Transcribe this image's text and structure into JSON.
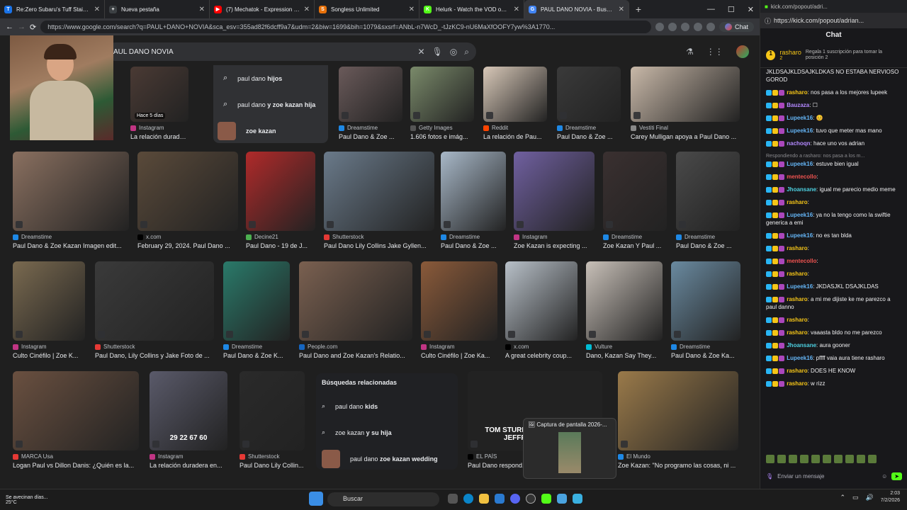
{
  "tabs": [
    {
      "title": "Re:Zero Subaru's Tuff Stairs Edit |",
      "color": "#1a73e8",
      "icon": "T"
    },
    {
      "title": "Nueva pestaña",
      "color": "#3c4043",
      "icon": "+"
    },
    {
      "title": "(7) Mechatok - Expression On You",
      "color": "#ff0000",
      "icon": "▶"
    },
    {
      "title": "Songless Unlimited",
      "color": "#e8710a",
      "icon": "S"
    },
    {
      "title": "Helurk - Watch the VOD on Kick",
      "color": "#53fc18",
      "icon": "K"
    },
    {
      "title": "PAUL DANO NOVIA - Buscar con G",
      "color": "#4285f4",
      "icon": "G"
    }
  ],
  "address": {
    "url": "https://www.google.com/search?q=PAUL+DANO+NOVIA&sca_esv=355ad82f6dcff9a7&udm=2&biw=1699&bih=1079&sxsrf=ANbL-n7WcD_-tJzKC9-nU6MaXfOOFY7yw%3A1770...",
    "chat_label": "Chat"
  },
  "search": {
    "query": "AUL DANO NOVIA"
  },
  "suggestions": [
    {
      "plain": "paul dano ",
      "bold": "hijos"
    },
    {
      "plain": "paul dano ",
      "bold": "y zoe kazan hija"
    },
    {
      "plain": "",
      "bold": "zoe kazan"
    }
  ],
  "row0": [
    {
      "source": "Instagram",
      "caption": "La relación duradera e...",
      "badge": "Hace 5 días",
      "color": "#4a3a34",
      "dot": "#c13584"
    },
    {
      "source": "Dreamstime",
      "caption": "Paul Dano & Zoe ...",
      "color": "#6a5a5a",
      "dot": "#1e88e5"
    },
    {
      "source": "Getty Images",
      "caption": "1.606 fotos e imág...",
      "color": "#7a8a6a",
      "dot": "#555"
    },
    {
      "source": "Reddit",
      "caption": "La relación de Pau...",
      "color": "#d8c8b8",
      "dot": "#ff4500"
    },
    {
      "source": "Dreamstime",
      "caption": "Paul Dano & Zoe ...",
      "color": "#3a3a3a",
      "dot": "#1e88e5"
    },
    {
      "source": "Vestiti Final",
      "caption": "Carey Mulligan apoya a Paul Dano ...",
      "color": "#c8b8a8",
      "dot": "#888"
    }
  ],
  "row1": [
    {
      "source": "Dreamstime",
      "caption": "Paul Dano & Zoe Kazan Imagen edit...",
      "color": "#8a7060",
      "dot": "#1e88e5"
    },
    {
      "source": "x.com",
      "caption": "February 29, 2024. Paul Dano ...",
      "color": "#5a4a3a",
      "dot": "#000"
    },
    {
      "source": "Decine21",
      "caption": "Paul Dano - 19 de J...",
      "color": "#b02a2a",
      "dot": "#4caf50"
    },
    {
      "source": "Shutterstock",
      "caption": "Paul Dano Lily Collins Jake Gyllen...",
      "color": "#6a7a8a",
      "dot": "#e53935"
    },
    {
      "source": "Dreamstime",
      "caption": "Paul Dano & Zoe ...",
      "color": "#a8b8c8",
      "dot": "#1e88e5"
    },
    {
      "source": "Instagram",
      "caption": "Zoe Kazan is expecting ...",
      "color": "#7060a0",
      "dot": "#c13584"
    },
    {
      "source": "Dreamstime",
      "caption": "Zoe Kazan Y Paul ...",
      "color": "#3a3030",
      "dot": "#1e88e5"
    },
    {
      "source": "Dreamstime",
      "caption": "Paul Dano & Zoe ...",
      "color": "#4a4a4a",
      "dot": "#1e88e5"
    }
  ],
  "row2": [
    {
      "source": "Instagram",
      "caption": "Culto Cinéfilo | Zoe K...",
      "color": "#7a6a50",
      "dot": "#c13584"
    },
    {
      "source": "Shutterstock",
      "caption": "Paul Dano, Lily Collins y Jake Foto de ...",
      "color": "#3a3a3a",
      "dot": "#e53935"
    },
    {
      "source": "Dreamstime",
      "caption": "Paul Dano & Zoe K...",
      "color": "#2a7a6a",
      "dot": "#1e88e5"
    },
    {
      "source": "People.com",
      "caption": "Paul Dano and Zoe Kazan's Relatio...",
      "color": "#7a6050",
      "dot": "#1565c0"
    },
    {
      "source": "Instagram",
      "caption": "Culto Cinéfilo | Zoe Ka...",
      "color": "#8a5a3a",
      "dot": "#c13584"
    },
    {
      "source": "x.com",
      "caption": "A great celebrity coup...",
      "color": "#b8c0c8",
      "dot": "#000"
    },
    {
      "source": "Vulture",
      "caption": "Dano, Kazan Say They...",
      "color": "#c8c0b8",
      "dot": "#00bcd4"
    },
    {
      "source": "Dreamstime",
      "caption": "Paul Dano & Zoe Ka...",
      "color": "#6a8aa0",
      "dot": "#1e88e5"
    }
  ],
  "row3": [
    {
      "source": "MARCA Usa",
      "caption": "Logan Paul vs Dillon Danis: ¿Quién es la...",
      "color": "#6a5040",
      "dot": "#e53935"
    },
    {
      "source": "Instagram",
      "caption": "La relación duradera en...",
      "overlay": "29 22 67 60",
      "color": "#5a5a6a",
      "dot": "#c13584"
    },
    {
      "source": "Shutterstock",
      "caption": "Paul Dano Lily Collin...",
      "color": "#2a2a2a",
      "dot": "#e53935"
    },
    {
      "source": "EL PAÍS",
      "caption": "Paul Dano respond...",
      "overlay": "TOM STURRIDGE WILL KEEN JEFFREY WRIGHT",
      "color": "#222",
      "dot": "#000"
    },
    {
      "source": "El Mundo",
      "caption": "Zoe Kazan: \"No programo las cosas, ni ...",
      "color": "#9a7a4a",
      "dot": "#1e88e5"
    }
  ],
  "related": {
    "title": "Búsquedas relacionadas",
    "items": [
      {
        "plain": "paul dano ",
        "bold": "kids"
      },
      {
        "plain": "zoe kazan ",
        "bold": "y su hija"
      },
      {
        "plain": "paul dano ",
        "bold": "zoe kazan wedding"
      }
    ]
  },
  "popup": {
    "title": "Captura de pantalla 2026-..."
  },
  "taskbar": {
    "weather_line1": "Se avecinan días...",
    "weather_line2": "25°C",
    "search": "Buscar",
    "time": "2:03",
    "date": "7/2/2026"
  },
  "chat": {
    "browser_url": "kick.com/popout/adri...",
    "url": "https://kick.com/popout/adrian...",
    "title": "Chat",
    "pinned_user": "rasharo",
    "pinned_count": "2",
    "pinned_text": "Regala 1 suscripción para tomar la posición 2",
    "input_placeholder": "Enviar un mensaje",
    "messages": [
      {
        "user": "",
        "color": "#efeff1",
        "text": "JKLDSAJKLDSAJKLDKAS NO ESTABA NERVIOSO GOROD"
      },
      {
        "user": "rasharo",
        "color": "#f5c518",
        "text": ": nos pasa a los mejores lupeek"
      },
      {
        "user": "Bauzaza",
        "color": "#b388ff",
        "text": ": ☐",
        "reply": ""
      },
      {
        "user": "Lupeek16",
        "color": "#64b5f6",
        "text": ": 😊"
      },
      {
        "user": "Lupeek16",
        "color": "#64b5f6",
        "text": ": tuvo que meter mas mano"
      },
      {
        "user": "nachoqn",
        "color": "#b388ff",
        "text": ": hace uno vos adrian"
      },
      {
        "user": "Lupeek16",
        "color": "#64b5f6",
        "text": ": estuve bien igual",
        "reply": "Respondiendo a rasharo: nos pasa a los m..."
      },
      {
        "user": "mentecollo",
        "color": "#ef5350",
        "text": ":"
      },
      {
        "user": "Jhoansane",
        "color": "#4dd0e1",
        "text": ": igual me parecio medio meme"
      },
      {
        "user": "rasharo",
        "color": "#f5c518",
        "text": ":"
      },
      {
        "user": "Lupeek16",
        "color": "#64b5f6",
        "text": ": ya no la tengo como la swiftie generica a emi"
      },
      {
        "user": "Lupeek16",
        "color": "#64b5f6",
        "text": ": no es tan blda"
      },
      {
        "user": "rasharo",
        "color": "#f5c518",
        "text": ":"
      },
      {
        "user": "mentecollo",
        "color": "#ef5350",
        "text": ":"
      },
      {
        "user": "rasharo",
        "color": "#f5c518",
        "text": ":"
      },
      {
        "user": "Lupeek16",
        "color": "#64b5f6",
        "text": ": JKDASJKL DSAJKLDAS"
      },
      {
        "user": "rasharo",
        "color": "#f5c518",
        "text": ": a mi me dijiste ke me parezco a paul danno"
      },
      {
        "user": "rasharo",
        "color": "#f5c518",
        "text": ":"
      },
      {
        "user": "rasharo",
        "color": "#f5c518",
        "text": ": vaaasta bldo no me parezco"
      },
      {
        "user": "Jhoansane",
        "color": "#4dd0e1",
        "text": ": aura gooner"
      },
      {
        "user": "Lupeek16",
        "color": "#64b5f6",
        "text": ": pffff vaia aura tiene rasharo"
      },
      {
        "user": "rasharo",
        "color": "#f5c518",
        "text": ": DOES HE KNOW"
      },
      {
        "user": "rasharo",
        "color": "#f5c518",
        "text": ": w rizz"
      }
    ]
  }
}
